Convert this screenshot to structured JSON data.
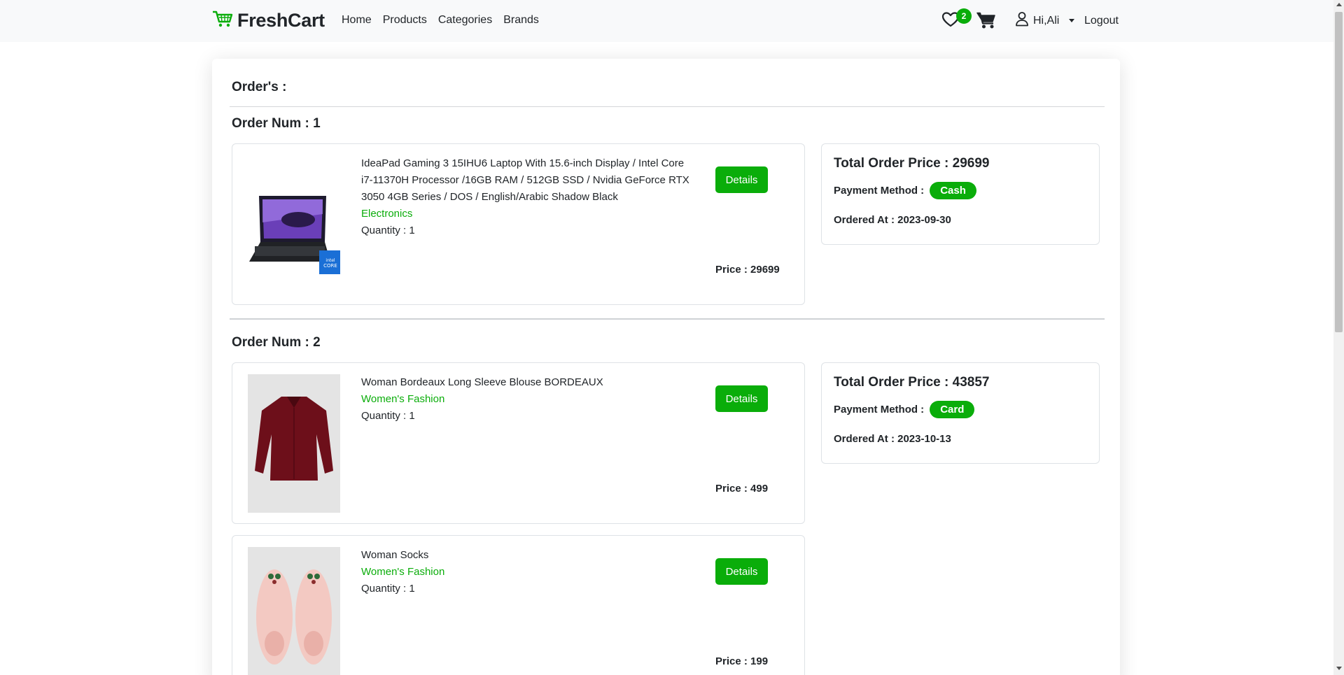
{
  "nav": {
    "brand": "FreshCart",
    "links": [
      "Home",
      "Products",
      "Categories",
      "Brands"
    ],
    "wishlist_count": "2",
    "user": "Hi,Ali",
    "logout": "Logout"
  },
  "page": {
    "title": "Order's :"
  },
  "orders": [
    {
      "title": "Order Num : 1",
      "items": [
        {
          "name": "IdeaPad Gaming 3 15IHU6 Laptop With 15.6-inch Display / Intel Core i7-11370H Processor /16GB RAM / 512GB SSD / Nvidia GeForce RTX 3050 4GB Series / DOS / English/Arabic Shadow Black",
          "category": "Electronics",
          "quantity": "Quantity : 1",
          "details": "Details",
          "price": "Price : 29699"
        }
      ],
      "summary": {
        "total": "Total Order Price : 29699",
        "payment_label": "Payment Method :",
        "payment_method": "Cash",
        "ordered_at": "Ordered At : 2023-09-30"
      }
    },
    {
      "title": "Order Num : 2",
      "items": [
        {
          "name": "Woman Bordeaux Long Sleeve Blouse BORDEAUX",
          "category": "Women's Fashion",
          "quantity": "Quantity : 1",
          "details": "Details",
          "price": "Price : 499"
        },
        {
          "name": "Woman Socks",
          "category": "Women's Fashion",
          "quantity": "Quantity : 1",
          "details": "Details",
          "price": "Price : 199"
        }
      ],
      "summary": {
        "total": "Total Order Price : 43857",
        "payment_label": "Payment Method :",
        "payment_method": "Card",
        "ordered_at": "Ordered At : 2023-10-13"
      }
    }
  ],
  "colors": {
    "accent": "#0aad0a",
    "navbar_bg": "#f8f9fa"
  },
  "icons": [
    "cart-logo-icon",
    "heart-icon",
    "shopping-cart-icon",
    "user-icon"
  ]
}
